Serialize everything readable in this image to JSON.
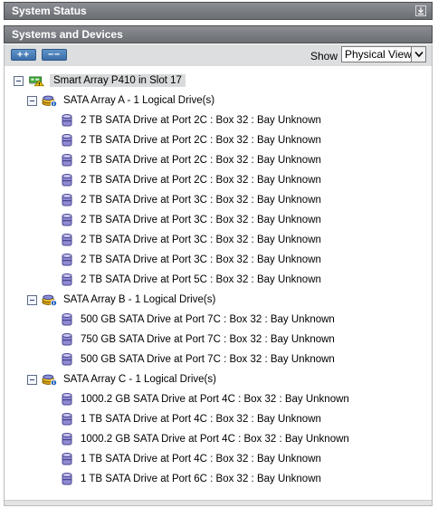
{
  "panels": {
    "system_status": "System Status",
    "systems_devices": "Systems and Devices"
  },
  "toolbar": {
    "expand_all": "++",
    "collapse_all": "−−",
    "show_label": "Show",
    "view_selected": "Physical View"
  },
  "tree": {
    "controller": "Smart Array P410 in Slot 17",
    "arrays": [
      {
        "label": "SATA Array A - 1 Logical Drive(s)",
        "drives": [
          "2 TB SATA Drive at Port 2C : Box 32 : Bay Unknown",
          "2 TB SATA Drive at Port 2C : Box 32 : Bay Unknown",
          "2 TB SATA Drive at Port 2C : Box 32 : Bay Unknown",
          "2 TB SATA Drive at Port 2C : Box 32 : Bay Unknown",
          "2 TB SATA Drive at Port 3C : Box 32 : Bay Unknown",
          "2 TB SATA Drive at Port 3C : Box 32 : Bay Unknown",
          "2 TB SATA Drive at Port 3C : Box 32 : Bay Unknown",
          "2 TB SATA Drive at Port 3C : Box 32 : Bay Unknown",
          "2 TB SATA Drive at Port 5C : Box 32 : Bay Unknown"
        ]
      },
      {
        "label": "SATA Array B - 1 Logical Drive(s)",
        "drives": [
          "500 GB SATA Drive at Port 7C : Box 32 : Bay Unknown",
          "750 GB SATA Drive at Port 7C : Box 32 : Bay Unknown",
          "500 GB SATA Drive at Port 7C : Box 32 : Bay Unknown"
        ]
      },
      {
        "label": "SATA Array C - 1 Logical Drive(s)",
        "drives": [
          "1000.2 GB SATA Drive at Port 4C : Box 32 : Bay Unknown",
          "1 TB SATA Drive at Port 4C : Box 32 : Bay Unknown",
          "1000.2 GB SATA Drive at Port 4C : Box 32 : Bay Unknown",
          "1 TB SATA Drive at Port 4C : Box 32 : Bay Unknown",
          "1 TB SATA Drive at Port 6C : Box 32 : Bay Unknown"
        ]
      }
    ]
  }
}
